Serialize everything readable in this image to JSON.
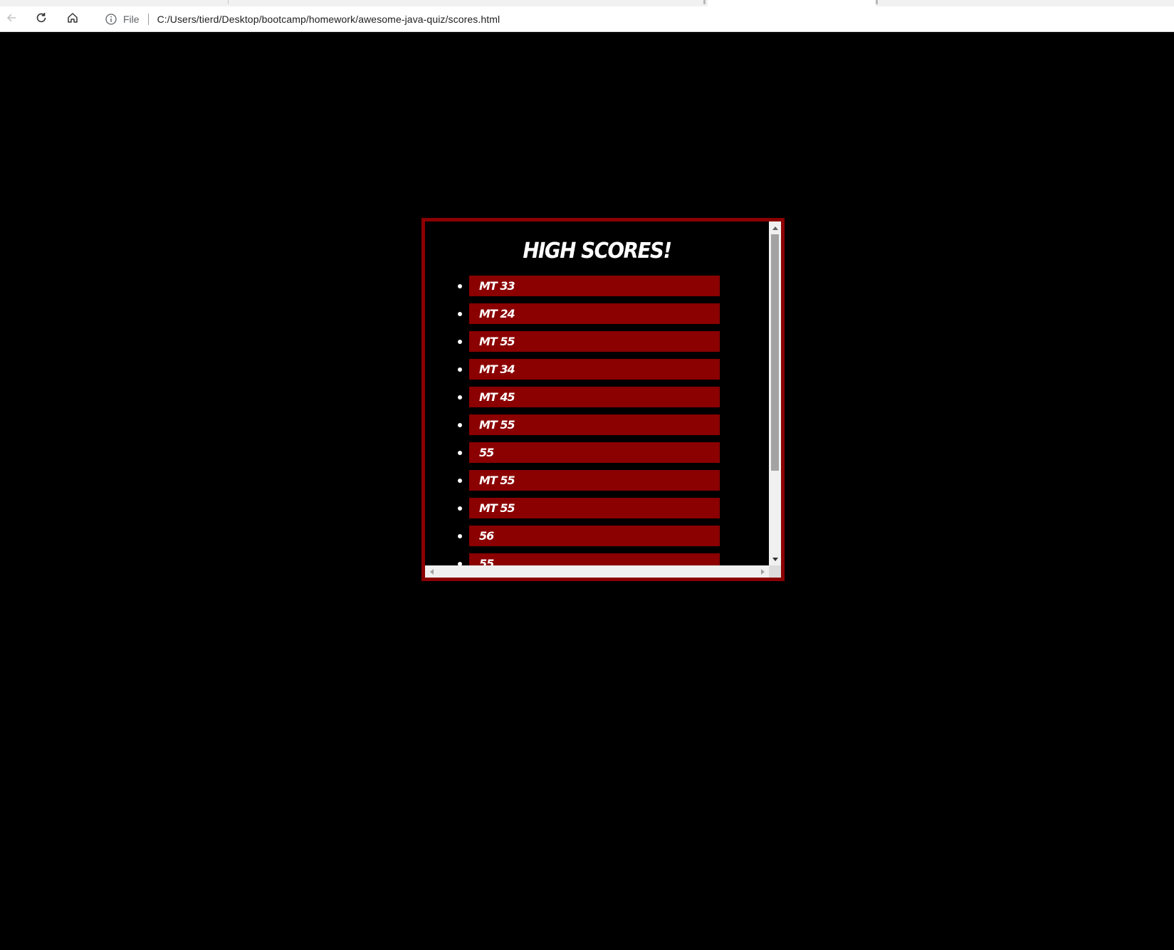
{
  "browser": {
    "address_scheme": "File",
    "address_url": "C:/Users/tierd/Desktop/bootcamp/homework/awesome-java-quiz/scores.html",
    "icons": [
      "back-arrow-icon",
      "reload-icon",
      "home-icon",
      "info-icon"
    ]
  },
  "page": {
    "title": "HIGH SCORES!",
    "scores": [
      "MT 33",
      "MT 24",
      "MT 55",
      "MT 34",
      "MT 45",
      "MT 55",
      "55",
      "MT 55",
      "MT 55",
      "56",
      "55"
    ],
    "colors": {
      "background": "#000000",
      "accent": "#8b0000",
      "text": "#ffffff"
    }
  }
}
